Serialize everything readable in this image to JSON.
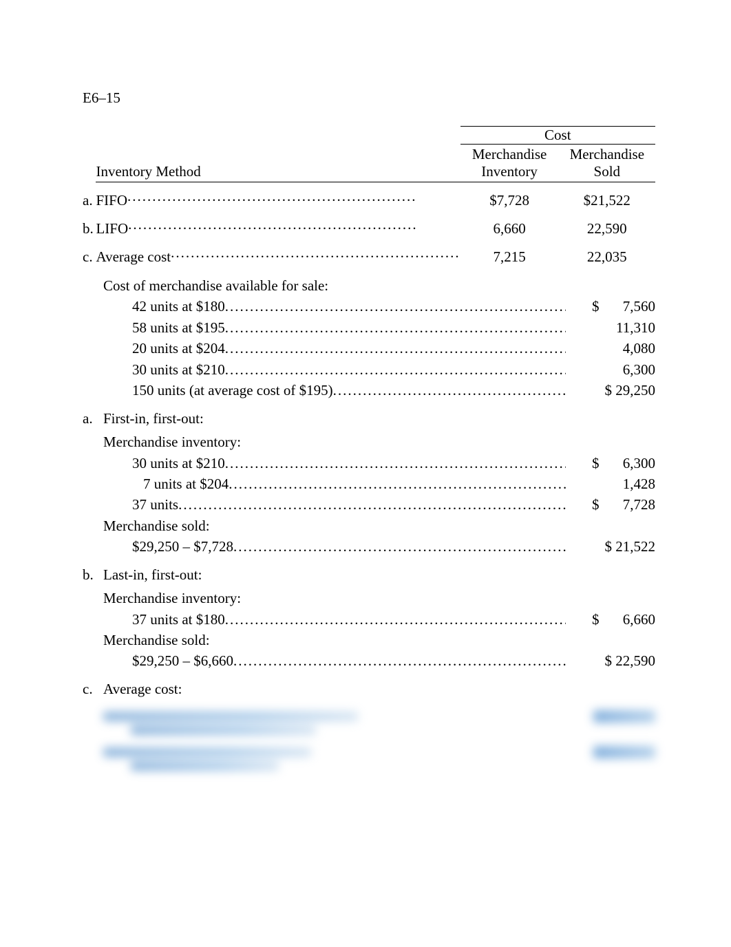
{
  "header": "E6–15",
  "table": {
    "cost_header": "Cost",
    "col_method": "Inventory Method",
    "col_inv": "Merchandise\nInventory",
    "col_sold": "Merchandise\nSold",
    "rows": [
      {
        "label": "a.",
        "name": "FIFO",
        "inv": "$7,728",
        "sold": "$21,522"
      },
      {
        "label": "b.",
        "name": "LIFO",
        "inv": "6,660",
        "sold": "22,590"
      },
      {
        "label": "c.",
        "name": "Average cost",
        "inv": "7,215",
        "sold": "22,035"
      }
    ]
  },
  "cost_avail": {
    "title": "Cost of merchandise available for sale:",
    "lines": [
      {
        "text": "42 units at $180",
        "amt": "$   7,560"
      },
      {
        "text": "58 units at $195",
        "amt": "11,310"
      },
      {
        "text": "20 units at $204",
        "amt": "4,080"
      },
      {
        "text": "30 units at $210",
        "amt": "6,300"
      },
      {
        "text": "150 units (at average cost of $195)",
        "amt": "$ 29,250"
      }
    ]
  },
  "sections": [
    {
      "label": "a.",
      "title": "First-in, first-out:",
      "groups": [
        {
          "heading": "Merchandise inventory:",
          "lines": [
            {
              "text": "30 units at $210",
              "amt": "$   6,300"
            },
            {
              "text": "7 units at $204",
              "amt": "1,428"
            },
            {
              "text": "37 units",
              "amt": "$   7,728"
            }
          ]
        },
        {
          "heading": "Merchandise sold:",
          "lines": [
            {
              "text": "$29,250 – $7,728",
              "amt": "$ 21,522"
            }
          ]
        }
      ]
    },
    {
      "label": "b.",
      "title": "Last-in, first-out:",
      "groups": [
        {
          "heading": "Merchandise inventory:",
          "lines": [
            {
              "text": "37 units at $180",
              "amt": "$   6,660"
            }
          ]
        },
        {
          "heading": "Merchandise sold:",
          "lines": [
            {
              "text": "$29,250 – $6,660",
              "amt": "$ 22,590"
            }
          ]
        }
      ]
    },
    {
      "label": "c.",
      "title": "Average cost:",
      "groups": []
    }
  ]
}
